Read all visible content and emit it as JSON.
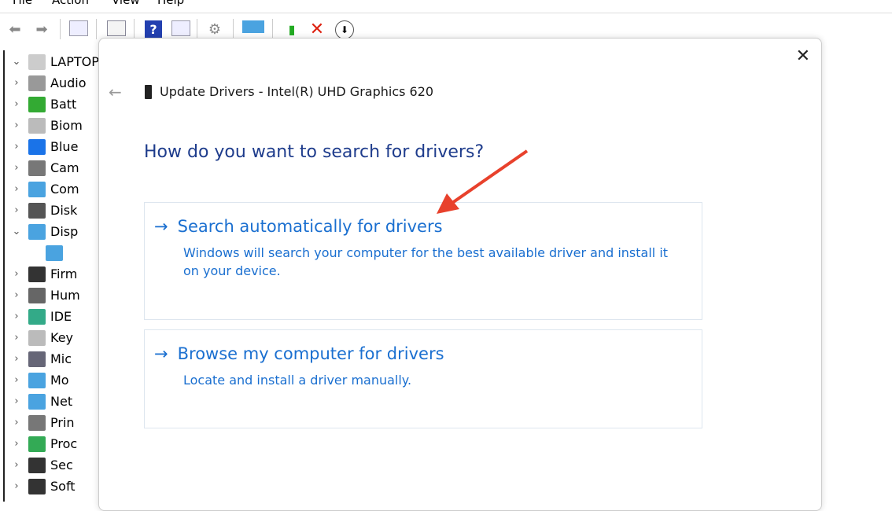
{
  "menu": [
    "File",
    "Action",
    "View",
    "Help"
  ],
  "toolbar": [
    "back-icon",
    "forward-icon",
    "show-hide-console-tree-icon",
    "properties-icon",
    "help-icon",
    "show-hide-action-pane-icon",
    "update-driver-icon",
    "scan-hardware-icon",
    "enable-device-icon",
    "uninstall-device-icon",
    "disable-device-icon"
  ],
  "tree": {
    "root": "LAPTOP",
    "items": [
      "Audio",
      "Batt",
      "Biom",
      "Blue",
      "Cam",
      "Com",
      "Disk",
      "Disp",
      "",
      "Firm",
      "Hum",
      "IDE",
      "Key",
      "Mic",
      "Mo",
      "Net",
      "Prin",
      "Proc",
      "Sec",
      "Soft"
    ]
  },
  "dialog": {
    "title": "Update Drivers - Intel(R) UHD Graphics 620",
    "heading": "How do you want to search for drivers?",
    "options": [
      {
        "title": "Search automatically for drivers",
        "desc": "Windows will search your computer for the best available driver and install it on your device."
      },
      {
        "title": "Browse my computer for drivers",
        "desc": "Locate and install a driver manually."
      }
    ]
  },
  "colors": {
    "accent": "#1a6fd0",
    "heading": "#1e3c8c",
    "annotation": "#e8412c"
  }
}
